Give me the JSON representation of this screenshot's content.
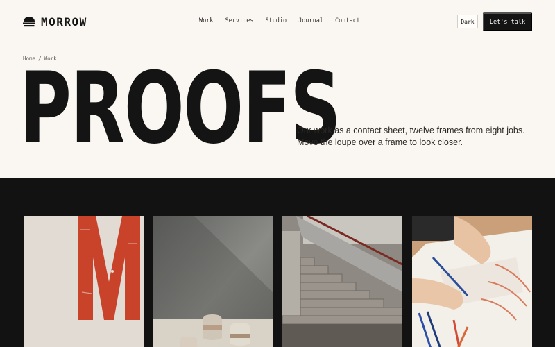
{
  "brand": {
    "name": "MORROW",
    "logo_icon": "hemisphere-stack-icon"
  },
  "nav": {
    "items": [
      {
        "label": "Work",
        "active": true
      },
      {
        "label": "Services",
        "active": false
      },
      {
        "label": "Studio",
        "active": false
      },
      {
        "label": "Journal",
        "active": false
      },
      {
        "label": "Contact",
        "active": false
      }
    ]
  },
  "header": {
    "theme_toggle_label": "Dark",
    "cta_label": "Let's talk"
  },
  "breadcrumb": {
    "home": "Home",
    "separator": "/",
    "current": "Work"
  },
  "hero": {
    "title": "PROOFS",
    "description_line1": "Our work as a contact sheet, twelve frames from eight jobs.",
    "description_line2": "Move the loupe over a frame to look closer."
  },
  "contact_sheet": {
    "background": "#121212",
    "frames": [
      {
        "subject": "red letterpress M poster"
      },
      {
        "subject": "ceramic vessels on a table"
      },
      {
        "subject": "concrete staircase with handrail"
      },
      {
        "subject": "hands sketching with colored pencils"
      }
    ]
  },
  "colors": {
    "page_bg": "#faf6f1",
    "ink": "#141414",
    "accent_red": "#c8432a"
  }
}
